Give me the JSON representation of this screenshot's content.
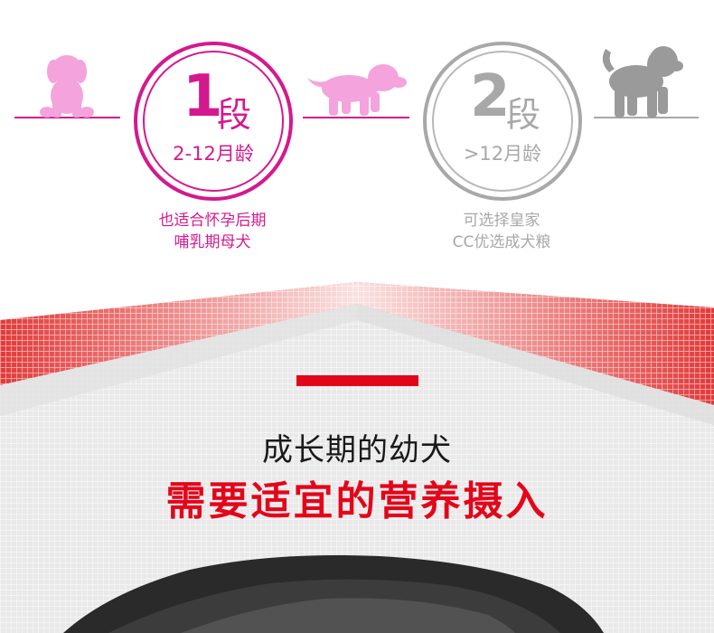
{
  "stages": [
    {
      "number": "1",
      "word": "段",
      "age": "2-12月龄",
      "note_line1": "也适合怀孕后期",
      "note_line2": "哺乳期母犬",
      "color": "#d4198f"
    },
    {
      "number": "2",
      "word": "段",
      "age": ">12月龄",
      "note_line1": "可选择皇家",
      "note_line2": "CC优选成犬粮",
      "color": "#a8a8a8"
    }
  ],
  "colors": {
    "pink_dog": "#f4a3dc",
    "gray_dog": "#9a9a9a",
    "brand_red": "#e3061b",
    "heading_dark": "#1a1a1a"
  },
  "icons": [
    "sitting-puppy-icon",
    "running-puppy-icon",
    "adult-dog-icon"
  ],
  "headline": {
    "line1": "成长期的幼犬",
    "line2": "需要适宜的营养摄入"
  }
}
